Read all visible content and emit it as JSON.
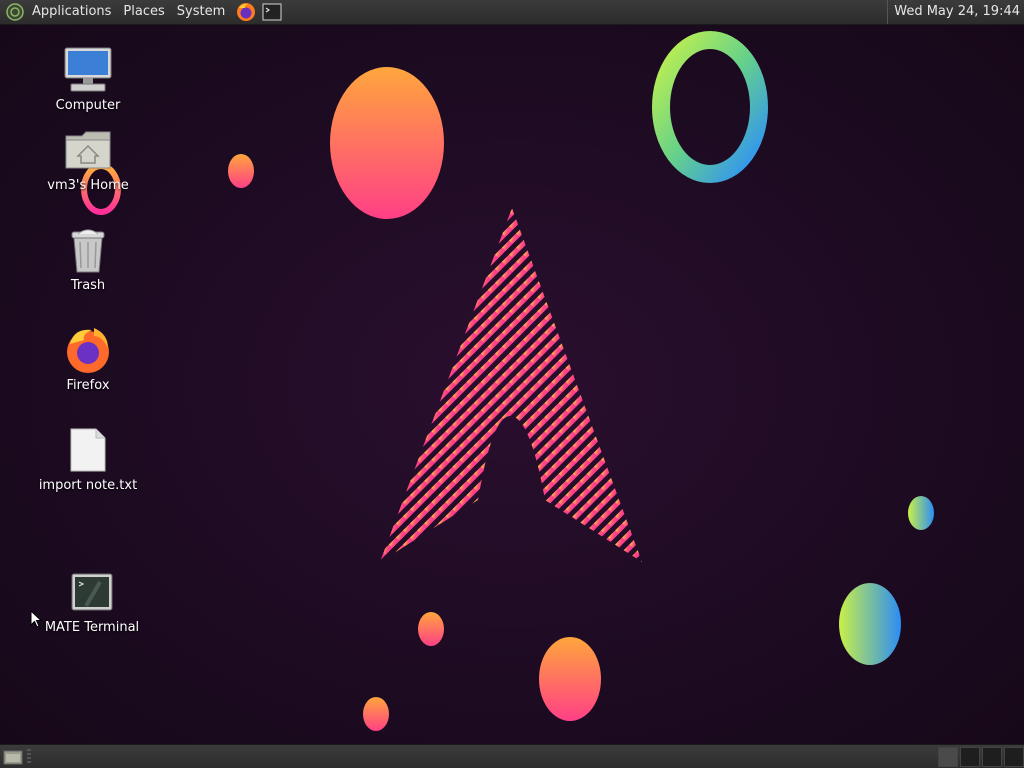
{
  "topbar": {
    "menus": [
      "Applications",
      "Places",
      "System"
    ],
    "clock": "Wed May 24, 19:44"
  },
  "desktop": {
    "icons": [
      {
        "label": "Computer",
        "icon": "computer-icon"
      },
      {
        "label": "vm3's Home",
        "icon": "home-folder-icon"
      },
      {
        "label": "Trash",
        "icon": "trash-icon"
      },
      {
        "label": "Firefox",
        "icon": "firefox-icon"
      },
      {
        "label": "import note.txt",
        "icon": "text-file-icon"
      },
      {
        "label": "MATE Terminal",
        "icon": "terminal-icon"
      }
    ]
  },
  "colors": {
    "panel": "#2c2c2c",
    "wallpaper": "#1d0b22",
    "accent_pink": "#ff2f8f",
    "accent_orange": "#ffa040"
  }
}
